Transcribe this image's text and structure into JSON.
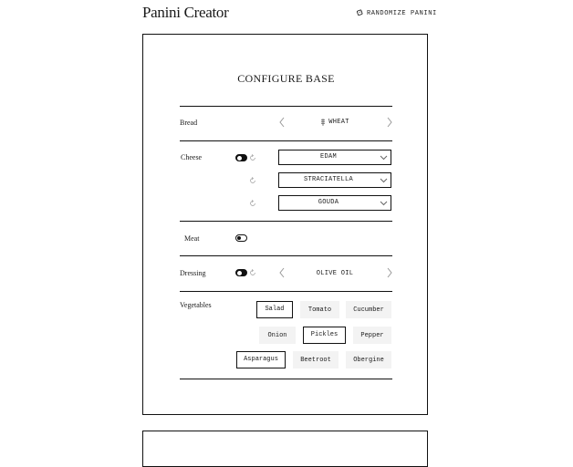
{
  "header": {
    "title": "Panini Creator",
    "randomize_label": "RANDOMIZE PANINI"
  },
  "base": {
    "title": "CONFIGURE BASE",
    "bread": {
      "label": "Bread",
      "value": "WHEAT"
    },
    "cheese": {
      "label": "Cheese",
      "enabled": true,
      "selections": [
        "EDAM",
        "STRACIATELLA",
        "GOUDA"
      ]
    },
    "meat": {
      "label": "Meat",
      "enabled": false
    },
    "dressing": {
      "label": "Dressing",
      "enabled": true,
      "value": "OLIVE OIL"
    },
    "vegetables": {
      "label": "Vegetables",
      "items": [
        {
          "name": "Salad",
          "selected": true
        },
        {
          "name": "Tomato",
          "selected": false
        },
        {
          "name": "Cucumber",
          "selected": false
        },
        {
          "name": "Onion",
          "selected": false
        },
        {
          "name": "Pickles",
          "selected": true
        },
        {
          "name": "Pepper",
          "selected": false
        },
        {
          "name": "Asparagus",
          "selected": true
        },
        {
          "name": "Beetroot",
          "selected": false
        },
        {
          "name": "Obergine",
          "selected": false
        }
      ]
    }
  },
  "icons": {
    "randomize": "dice-icon",
    "prev": "chevron-left-icon",
    "next": "chevron-right-icon",
    "bread": "wheat-icon",
    "cycle": "refresh-icon",
    "dropdown": "chevron-down-icon"
  }
}
